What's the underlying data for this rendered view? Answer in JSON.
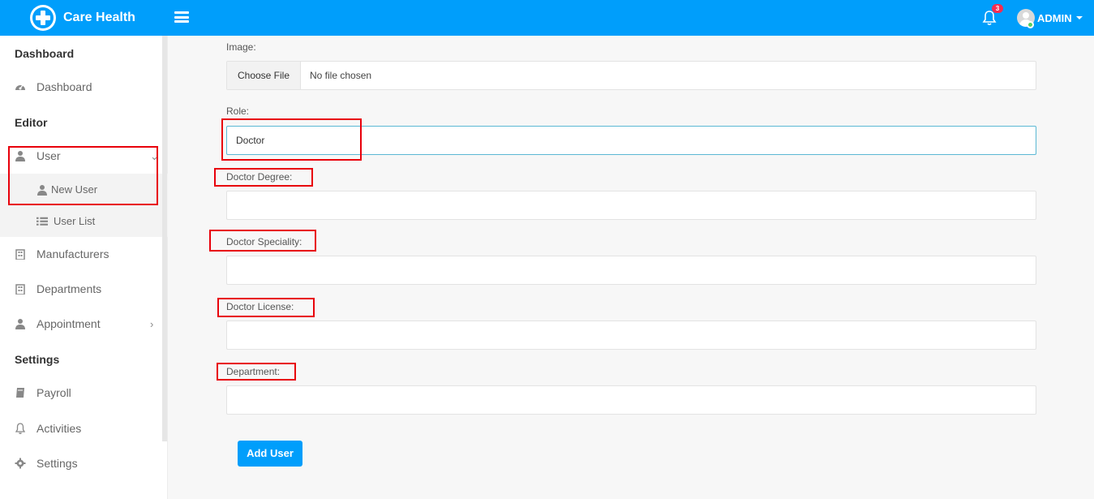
{
  "header": {
    "brand_name": "Care Health",
    "notification_count": "3",
    "user_name": "ADMIN",
    "accent_color": "#009efb",
    "icons": [
      "medical-cross-logo-icon",
      "hamburger-menu-icon",
      "bell-icon",
      "user-avatar-icon",
      "caret-down-icon"
    ]
  },
  "sidebar": {
    "sections": {
      "dashboard": "Dashboard",
      "editor": "Editor",
      "settings": "Settings"
    },
    "items": {
      "dashboard": "Dashboard",
      "user": "User",
      "new_user": "New User",
      "user_list": "User List",
      "manufacturers": "Manufacturers",
      "departments": "Departments",
      "appointment": "Appointment",
      "payroll": "Payroll",
      "activities": "Activities",
      "settings": "Settings"
    }
  },
  "form": {
    "image_label": "Image:",
    "file_button": "Choose File",
    "file_status": "No file chosen",
    "role_label": "Role:",
    "role_value": "Doctor",
    "degree_label": "Doctor Degree:",
    "degree_value": "",
    "speciality_label": "Doctor Speciality:",
    "speciality_value": "",
    "license_label": "Doctor License:",
    "license_value": "",
    "department_label": "Department:",
    "department_value": "",
    "submit_label": "Add User"
  }
}
